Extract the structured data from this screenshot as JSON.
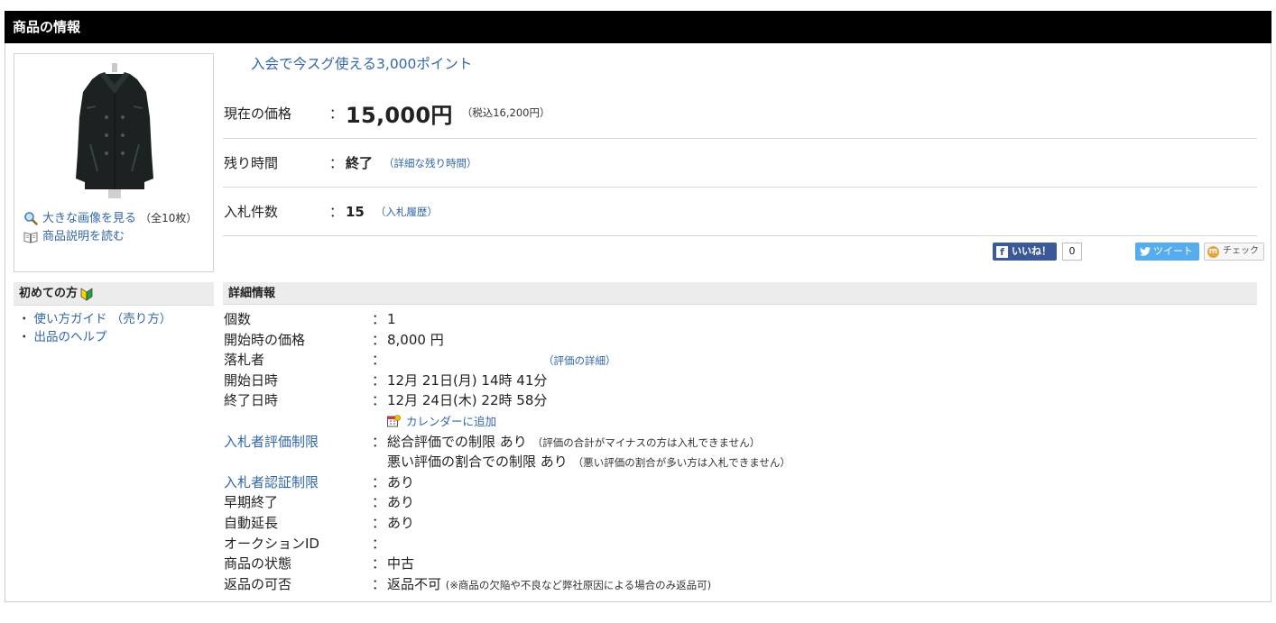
{
  "header": {
    "title": "商品の情報"
  },
  "image_panel": {
    "large_image_link": "大きな画像を見る",
    "image_count": "（全10枚）",
    "description_link": "商品説明を読む"
  },
  "beginner": {
    "title": "初めての方",
    "links": [
      "使い方ガイド （売り方）",
      "出品のヘルプ"
    ]
  },
  "promo": "入会で今スグ使える3,000ポイント",
  "summary": {
    "colon": "：",
    "price": {
      "label": "現在の価格",
      "value": "15,000円",
      "tax_note": "（税込16,200円）"
    },
    "time_left": {
      "label": "残り時間",
      "value": "終了",
      "link": "（詳細な残り時間）"
    },
    "bids": {
      "label": "入札件数",
      "value": "15",
      "link": "（入札履歴）"
    }
  },
  "social": {
    "facebook_label": "いいね！",
    "facebook_letter": "f",
    "facebook_count": "0",
    "twitter_label": "ツイート",
    "mixi_label": "チェック",
    "mixi_letter": "m"
  },
  "details": {
    "title": "詳細情報",
    "colon": "：",
    "quantity": {
      "label": "個数",
      "value": "1"
    },
    "start_price": {
      "label": "開始時の価格",
      "value": "8,000 円"
    },
    "winner": {
      "label": "落札者",
      "link": "（評価の詳細）"
    },
    "start_date": {
      "label": "開始日時",
      "value": "12月 21日(月) 14時 41分"
    },
    "end_date": {
      "label": "終了日時",
      "value": "12月 24日(木) 22時 58分"
    },
    "calendar_link": "カレンダーに追加",
    "rating_limit": {
      "label": "入札者評価制限",
      "line1": "総合評価での制限 あり",
      "note1": "（評価の合計がマイナスの方は入札できません）",
      "line2": "悪い評価の割合での制限 あり",
      "note2": "（悪い評価の割合が多い方は入札できません）"
    },
    "auth_limit": {
      "label": "入札者認証制限",
      "value": "あり"
    },
    "early_end": {
      "label": "早期終了",
      "value": "あり"
    },
    "auto_extend": {
      "label": "自動延長",
      "value": "あり"
    },
    "auction_id": {
      "label": "オークションID",
      "value": ""
    },
    "condition": {
      "label": "商品の状態",
      "value": "中古"
    },
    "returns": {
      "label": "返品の可否",
      "value": "返品不可",
      "note": "(※商品の欠陥や不良など弊社原因による場合のみ返品可)"
    }
  },
  "colors": {
    "link": "#3366aa",
    "header_bg": "#000000",
    "section_bg": "#ececec",
    "facebook": "#3b5998",
    "twitter": "#55acee"
  }
}
